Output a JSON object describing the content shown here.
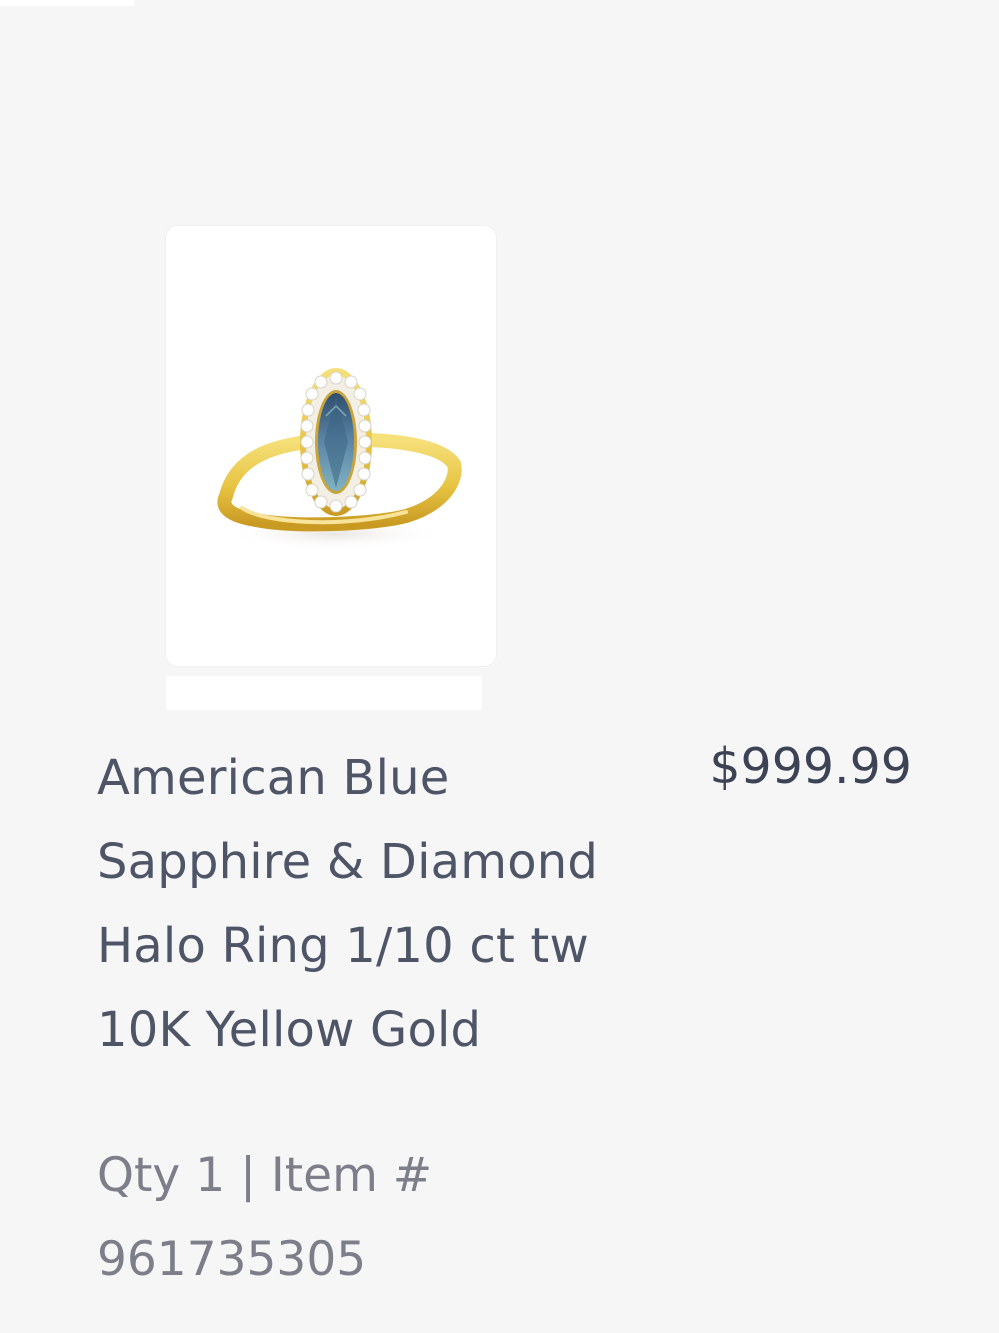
{
  "product": {
    "title": "American Blue Sapphire & Diamond Halo Ring 1/10 ct tw 10K Yellow Gold",
    "price": "$999.99",
    "qty_label": "Qty",
    "qty": "1",
    "separator": "|",
    "item_label": "Item #",
    "item_number": "961735305",
    "image_icon": "ring-image"
  },
  "colors": {
    "background": "#f6f6f7",
    "title_text": "#4e5567",
    "price_text": "#3c4355",
    "meta_text": "#7c7f89",
    "gold": "#e9c84b",
    "sapphire": "#5e86a3"
  }
}
